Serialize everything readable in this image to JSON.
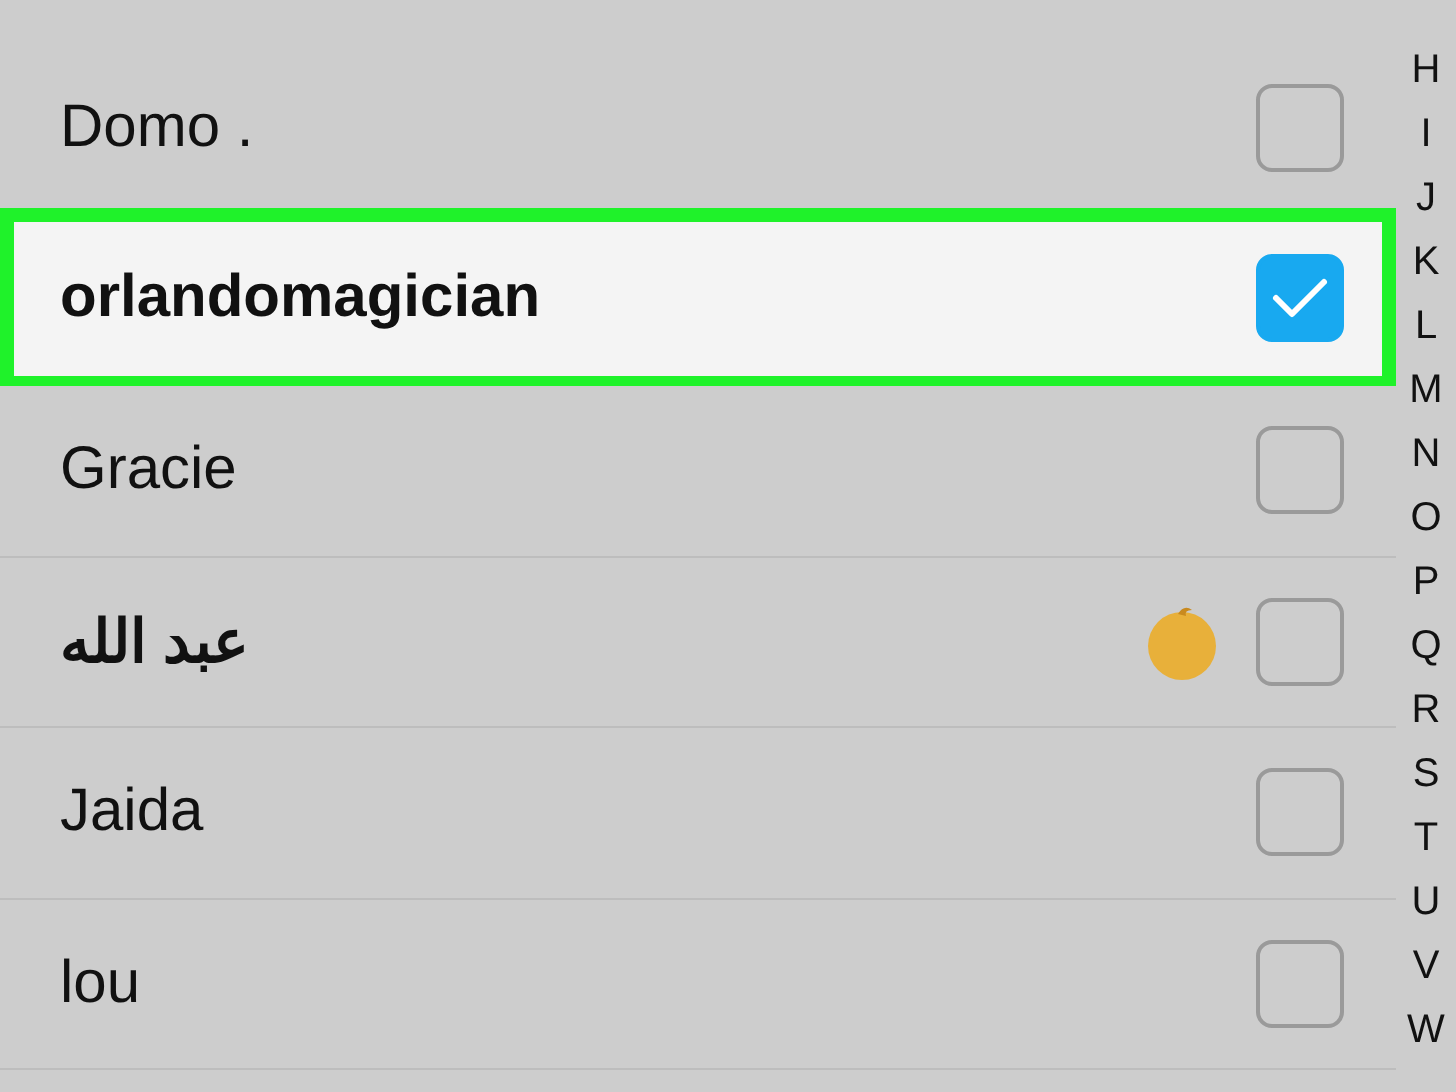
{
  "contacts": [
    {
      "name": "Domo .",
      "checked": false,
      "highlighted": false
    },
    {
      "name": "orlandomagician",
      "checked": true,
      "highlighted": true
    },
    {
      "name": "Gracie",
      "checked": false,
      "highlighted": false
    },
    {
      "name": "عبد الله",
      "checked": false,
      "highlighted": false,
      "kind": "emoji"
    },
    {
      "name": "Jaida",
      "checked": false,
      "highlighted": false
    },
    {
      "name": "lou",
      "checked": false,
      "highlighted": false
    }
  ],
  "index_letters": [
    "H",
    "I",
    "J",
    "K",
    "L",
    "M",
    "N",
    "O",
    "P",
    "Q",
    "R",
    "S",
    "T",
    "U",
    "V",
    "W"
  ]
}
